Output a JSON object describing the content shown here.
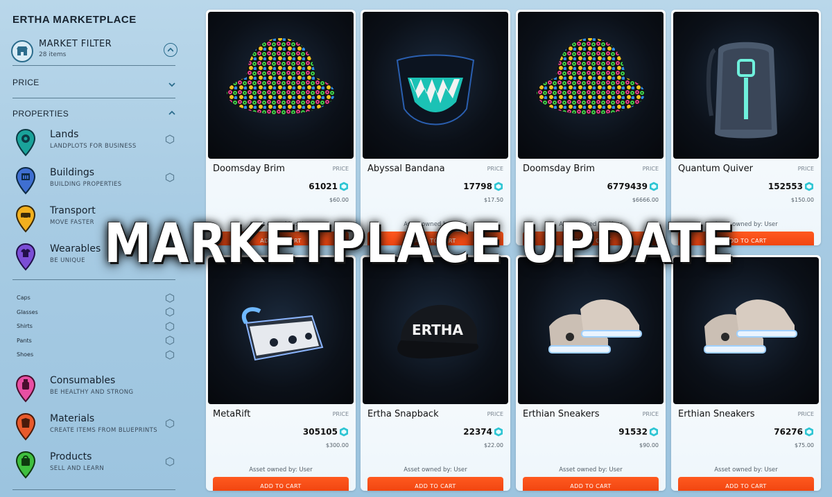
{
  "sidebar": {
    "title": "ERTHA MARKETPLACE",
    "market_filter": {
      "title": "MARKET FILTER",
      "count": "28 items"
    },
    "price_label": "PRICE",
    "properties_label": "PROPERTIES",
    "categories": [
      {
        "name": "Lands",
        "sub": "LANDPLOTS FOR BUSINESS",
        "color": "#1aa39a",
        "icon": "map-pin-icon"
      },
      {
        "name": "Buildings",
        "sub": "BUILDING PROPERTIES",
        "color": "#3f6fd1",
        "icon": "building-icon"
      },
      {
        "name": "Transport",
        "sub": "MOVE FASTER",
        "color": "#f2b01e",
        "icon": "car-icon"
      },
      {
        "name": "Wearables",
        "sub": "BE UNIQUE",
        "color": "#7b4ed6",
        "icon": "shirt-icon"
      }
    ],
    "wearable_subitems": [
      "Caps",
      "Glasses",
      "Shirts",
      "Pants",
      "Shoes"
    ],
    "more_categories": [
      {
        "name": "Consumables",
        "sub": "BE HEALTHY AND STRONG",
        "color": "#e84fa3",
        "icon": "bottle-icon"
      },
      {
        "name": "Materials",
        "sub": "CREATE ITEMS FROM BLUEPRINTS",
        "color": "#e85a2c",
        "icon": "material-icon"
      },
      {
        "name": "Products",
        "sub": "SELL AND LEARN",
        "color": "#3fbf3f",
        "icon": "bag-icon"
      }
    ]
  },
  "cards": [
    {
      "name": "Doomsday Brim",
      "price_label": "PRICE",
      "price": "61021",
      "usd": "$60.00",
      "owner": "Asset owned by: User",
      "button": "ADD TO CART",
      "item": "bucket-hat"
    },
    {
      "name": "Abyssal Bandana",
      "price_label": "PRICE",
      "price": "17798",
      "usd": "$17.50",
      "owner": "Asset owned by: User",
      "button": "ADD TO CART",
      "item": "mask"
    },
    {
      "name": "Doomsday Brim",
      "price_label": "PRICE",
      "price": "6779439",
      "usd": "$6666.00",
      "owner": "Asset owned by: User",
      "button": "ADD TO CART",
      "item": "bucket-hat"
    },
    {
      "name": "Quantum Quiver",
      "price_label": "PRICE",
      "price": "152553",
      "usd": "$150.00",
      "owner": "Asset owned by: User",
      "button": "ADD TO CART",
      "item": "backpack"
    },
    {
      "name": "MetaRift",
      "price_label": "PRICE",
      "price": "305105",
      "usd": "$300.00",
      "owner": "Asset owned by: User",
      "button": "ADD TO CART",
      "item": "vr-headset"
    },
    {
      "name": "Ertha Snapback",
      "price_label": "PRICE",
      "price": "22374",
      "usd": "$22.00",
      "owner": "Asset owned by: User",
      "button": "ADD TO CART",
      "item": "cap"
    },
    {
      "name": "Erthian Sneakers",
      "price_label": "PRICE",
      "price": "91532",
      "usd": "$90.00",
      "owner": "Asset owned by: User",
      "button": "ADD TO CART",
      "item": "sneakers"
    },
    {
      "name": "Erthian Sneakers",
      "price_label": "PRICE",
      "price": "76276",
      "usd": "$75.00",
      "owner": "Asset owned by: User",
      "button": "ADD TO CART",
      "item": "sneakers"
    }
  ],
  "cap_logo_text": "ERTHA",
  "overlay_title": "MARKETPLACE UPDATE",
  "colors": {
    "accent": "#ff5a1f",
    "gem": "#2ec5d3",
    "sidebar_line": "#5a7d93"
  }
}
